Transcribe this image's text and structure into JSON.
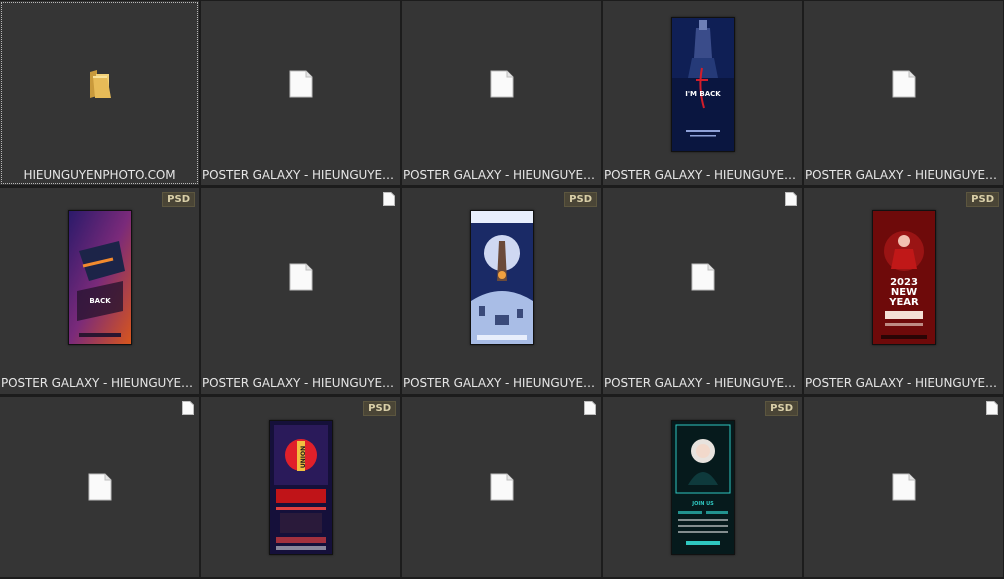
{
  "files": [
    {
      "name": "HIEUNGUYENPHOTO.COM",
      "kind": "folder-icon"
    },
    {
      "name": "POSTER GALAXY - HIEUNGUYENPHOTO.COM",
      "kind": "document-icon"
    },
    {
      "name": "POSTER GALAXY - HIEUNGUYENPHOTO.COM",
      "kind": "document-icon"
    },
    {
      "name": "POSTER GALAXY - HIEUNGUYENPHOTO.COM",
      "kind": "poster-thumbnail",
      "text": "I'M BACK"
    },
    {
      "name": "POSTER GALAXY - HIEUNGUYENPHOTO.COM",
      "kind": "document-icon"
    },
    {
      "name": "POSTER GALAXY - HIEUNGUYENPHOTO.COM",
      "kind": "poster-thumbnail",
      "badge": "PSD",
      "text": "BACK"
    },
    {
      "name": "POSTER GALAXY - HIEUNGUYENPHOTO.COM",
      "kind": "document-icon"
    },
    {
      "name": "POSTER GALAXY - HIEUNGUYENPHOTO.COM",
      "kind": "poster-thumbnail",
      "badge": "PSD"
    },
    {
      "name": "POSTER GALAXY - HIEUNGUYENPHOTO.COM",
      "kind": "document-icon"
    },
    {
      "name": "POSTER GALAXY - HIEUNGUYENPHOTO.COM",
      "kind": "poster-thumbnail",
      "badge": "PSD",
      "text": "2023 NEW YEAR"
    },
    {
      "name": "",
      "kind": "document-icon"
    },
    {
      "name": "",
      "kind": "poster-thumbnail",
      "badge": "PSD",
      "text": "UNION"
    },
    {
      "name": "",
      "kind": "document-icon"
    },
    {
      "name": "",
      "kind": "poster-thumbnail",
      "badge": "PSD",
      "text": "JOIN US"
    },
    {
      "name": "",
      "kind": "document-icon"
    }
  ],
  "colors": {
    "background": "#1c1c1c",
    "tile": "#353535",
    "caption": "#e6e6e6",
    "badge_bg": "#4a4536",
    "badge_text": "#d9cfa8"
  }
}
